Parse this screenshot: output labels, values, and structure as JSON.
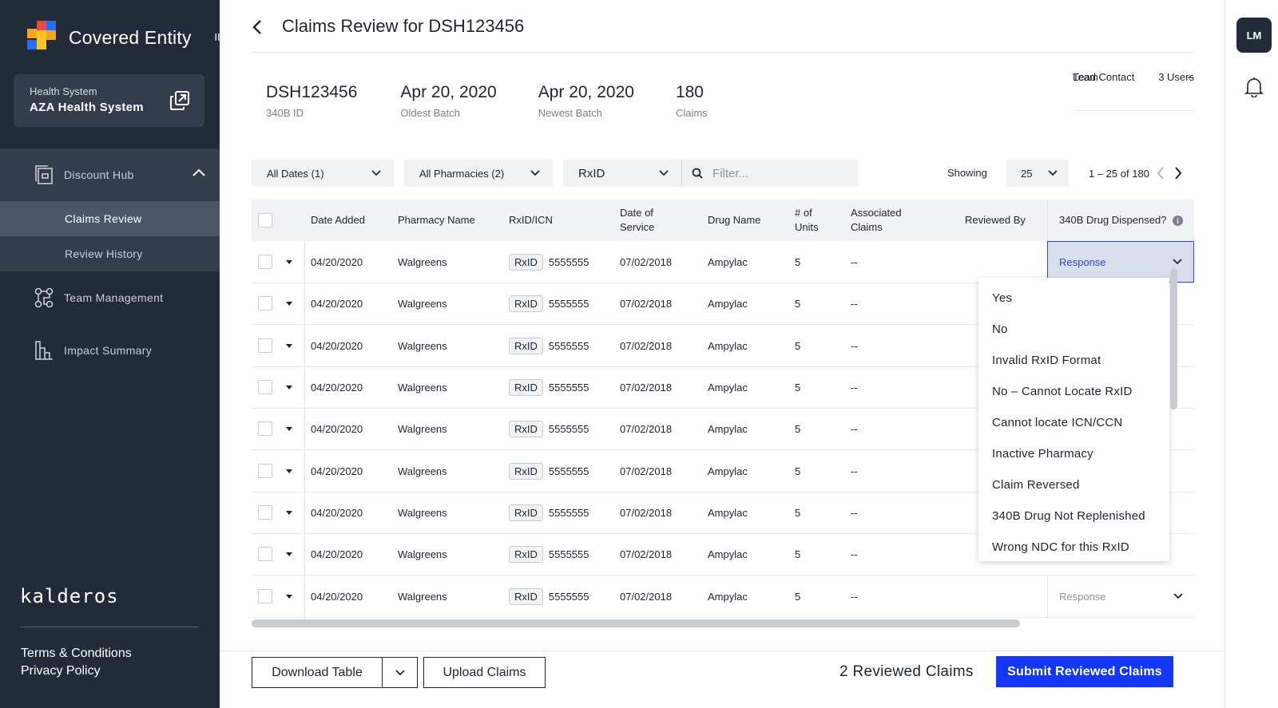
{
  "sidebar": {
    "brand_title": "Covered Entity",
    "collapse_label": "II",
    "org_label": "Health System",
    "org_name": "AZA Health System",
    "nav": {
      "discount_hub": "Discount Hub",
      "claims_review": "Claims Review",
      "review_history": "Review History",
      "team_management": "Team Management",
      "impact_summary": "Impact Summary"
    },
    "footer_brand": "kalderos",
    "terms": "Terms & Conditions",
    "privacy": "Privacy Policy"
  },
  "header": {
    "title": "Claims Review for DSH123456"
  },
  "stats": [
    {
      "value": "DSH123456",
      "label": "340B ID"
    },
    {
      "value": "Apr 20, 2020",
      "label": "Oldest Batch"
    },
    {
      "value": "Apr 20, 2020",
      "label": "Newest Batch"
    },
    {
      "value": "180",
      "label": "Claims"
    }
  ],
  "lead": {
    "lead_label": "Lead Contact",
    "lead_value": "--",
    "team_label": "Team",
    "team_value": "3 Users"
  },
  "filters": {
    "dates": "All Dates (1)",
    "pharmacies": "All Pharmacies (2)",
    "id_type": "RxID",
    "search_placeholder": "Filter...",
    "showing_label": "Showing",
    "page_size": "25",
    "range": "1 – 25 of 180"
  },
  "table": {
    "headers": {
      "date_added": "Date Added",
      "pharmacy": "Pharmacy Name",
      "rxid": "RxID/ICN",
      "date_of_service_1": "Date of",
      "date_of_service_2": "Service",
      "drug": "Drug Name",
      "units_1": "# of",
      "units_2": "Units",
      "assoc_1": "Associated",
      "assoc_2": "Claims",
      "reviewed_by": "Reviewed By",
      "dispensed": "340B Drug Dispensed?"
    },
    "rows": [
      {
        "date": "04/20/2020",
        "pharmacy": "Walgreens",
        "tag": "RxID",
        "rxid": "5555555",
        "dos": "07/02/2018",
        "drug": "Ampylac",
        "units": "5",
        "assoc": "--",
        "response": "Response"
      },
      {
        "date": "04/20/2020",
        "pharmacy": "Walgreens",
        "tag": "RxID",
        "rxid": "5555555",
        "dos": "07/02/2018",
        "drug": "Ampylac",
        "units": "5",
        "assoc": "--",
        "response": ""
      },
      {
        "date": "04/20/2020",
        "pharmacy": "Walgreens",
        "tag": "RxID",
        "rxid": "5555555",
        "dos": "07/02/2018",
        "drug": "Ampylac",
        "units": "5",
        "assoc": "--",
        "response": ""
      },
      {
        "date": "04/20/2020",
        "pharmacy": "Walgreens",
        "tag": "RxID",
        "rxid": "5555555",
        "dos": "07/02/2018",
        "drug": "Ampylac",
        "units": "5",
        "assoc": "--",
        "response": ""
      },
      {
        "date": "04/20/2020",
        "pharmacy": "Walgreens",
        "tag": "RxID",
        "rxid": "5555555",
        "dos": "07/02/2018",
        "drug": "Ampylac",
        "units": "5",
        "assoc": "--",
        "response": ""
      },
      {
        "date": "04/20/2020",
        "pharmacy": "Walgreens",
        "tag": "RxID",
        "rxid": "5555555",
        "dos": "07/02/2018",
        "drug": "Ampylac",
        "units": "5",
        "assoc": "--",
        "response": ""
      },
      {
        "date": "04/20/2020",
        "pharmacy": "Walgreens",
        "tag": "RxID",
        "rxid": "5555555",
        "dos": "07/02/2018",
        "drug": "Ampylac",
        "units": "5",
        "assoc": "--",
        "response": ""
      },
      {
        "date": "04/20/2020",
        "pharmacy": "Walgreens",
        "tag": "RxID",
        "rxid": "5555555",
        "dos": "07/02/2018",
        "drug": "Ampylac",
        "units": "5",
        "assoc": "--",
        "response": ""
      },
      {
        "date": "04/20/2020",
        "pharmacy": "Walgreens",
        "tag": "RxID",
        "rxid": "5555555",
        "dos": "07/02/2018",
        "drug": "Ampylac",
        "units": "5",
        "assoc": "--",
        "response": "Response"
      }
    ]
  },
  "dropdown_options": [
    "Yes",
    "No",
    "Invalid RxID Format",
    "No – Cannot Locate RxID",
    "Cannot locate ICN/CCN",
    "Inactive Pharmacy",
    "Claim Reversed",
    "340B Drug Not Replenished",
    "Wrong NDC for this RxID"
  ],
  "footer": {
    "download": "Download Table",
    "upload": "Upload Claims",
    "reviewed_count": "2 Reviewed Claims",
    "submit": "Submit Reviewed Claims"
  },
  "user": {
    "initials": "LM"
  },
  "colors": {
    "sidebar_bg": "#232a38",
    "accent_blue": "#1437f5",
    "selected_blue": "#2a48e6"
  }
}
